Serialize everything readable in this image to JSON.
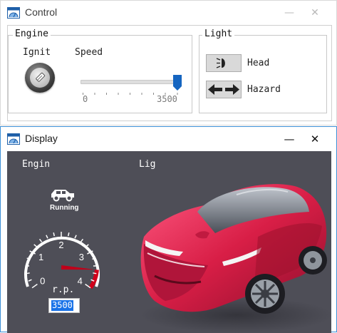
{
  "control_window": {
    "title": "Control",
    "minimize_glyph": "—",
    "close_glyph": "✕",
    "engine_group": {
      "legend": "Engine",
      "ignition_label": "Ignit",
      "speed_label": "Speed",
      "speed_min_label": "0",
      "speed_max_label": "3500",
      "speed_value_fraction": 1.0
    },
    "light_group": {
      "legend": "Light",
      "head_label": "Head",
      "hazard_label": "Hazard"
    }
  },
  "display_window": {
    "title": "Display",
    "minimize_glyph": "—",
    "close_glyph": "✕",
    "engine_label": "Engin",
    "light_label": "Lig",
    "engine_status": "Running",
    "gauge": {
      "tick_labels": [
        "0",
        "1",
        "2",
        "3",
        "4"
      ],
      "rpm_label": "r.p.",
      "needle_value": 3.5,
      "max_value": 4
    },
    "rpm_value": "3500"
  },
  "colors": {
    "accent": "#1565c0",
    "gauge_red": "#d0021b",
    "car_body": "#d81e46",
    "panel_bg": "#4e4e57"
  },
  "icons": [
    "window-app-icon",
    "ignition-key-icon",
    "slider-thumb-icon",
    "headlight-icon",
    "hazard-arrows-icon",
    "car-running-icon",
    "car-image"
  ]
}
